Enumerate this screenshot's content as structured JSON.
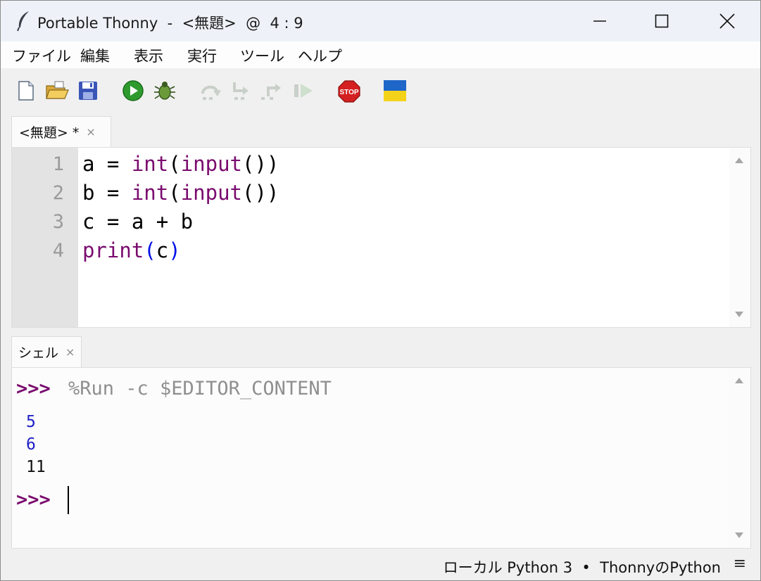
{
  "window": {
    "title": "Portable Thonny  -  <無題>  @  4 : 9"
  },
  "menu": {
    "items": [
      "ファイル",
      "編集",
      "表示",
      "実行",
      "ツール",
      "ヘルプ"
    ]
  },
  "toolbar": {
    "buttons": [
      "new-file-icon",
      "open-file-icon",
      "save-icon",
      "run-icon",
      "debug-icon",
      "step-over-icon",
      "step-into-icon",
      "step-out-icon",
      "resume-icon",
      "stop-icon",
      "ukraine-flag-icon"
    ],
    "stop_label": "STOP",
    "colors": {
      "run": "#2e9a2e",
      "stop": "#d42020",
      "flag_blue": "#1f66c9",
      "flag_yellow": "#f5d21a"
    }
  },
  "editor": {
    "tab_label": "<無題> *",
    "tab_close": "×",
    "line_numbers": [
      "1",
      "2",
      "3",
      "4"
    ],
    "lines": [
      {
        "a": "a = ",
        "b": "int",
        "c": "(",
        "d": "input",
        "e": "())"
      },
      {
        "a": "b = ",
        "b": "int",
        "c": "(",
        "d": "input",
        "e": "())"
      },
      {
        "a": "c = a + b"
      },
      {
        "kw": "print",
        "open": "(",
        "arg": "c",
        "close": ")"
      }
    ]
  },
  "shell": {
    "tab_label": "シェル",
    "tab_close": "×",
    "prompt": ">>>",
    "command": "%Run -c $EDITOR_CONTENT",
    "outputs": [
      {
        "text": "5",
        "color": "#2020c8"
      },
      {
        "text": "6",
        "color": "#2020c8"
      },
      {
        "text": "11",
        "color": "#111111"
      }
    ],
    "prompt2": ">>>"
  },
  "statusbar": {
    "text": "ローカル Python 3  •  ThonnyのPython",
    "menu_icon": "≡"
  }
}
